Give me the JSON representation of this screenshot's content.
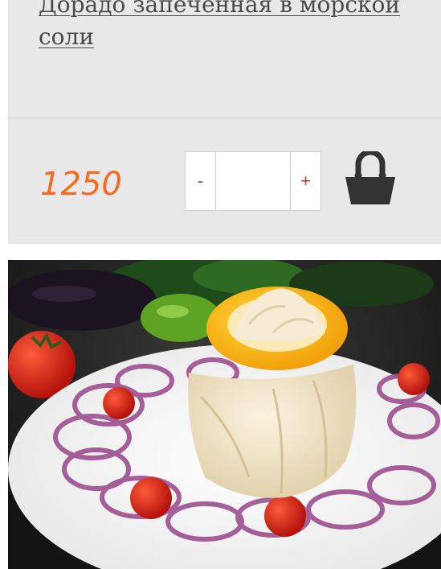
{
  "product": {
    "title": "Дорадо запеченная в морской соли",
    "price": "1250",
    "image_alt": "dorado-dish-photo"
  },
  "quantity": {
    "minus_label": "-",
    "plus_label": "+",
    "value": ""
  },
  "icons": {
    "cart": "shopping-bag-icon"
  },
  "colors": {
    "price": "#f26b1f",
    "qty_buttons": "#c0392b",
    "card_bg": "#e8e8e8",
    "title": "#4a4a4a"
  }
}
